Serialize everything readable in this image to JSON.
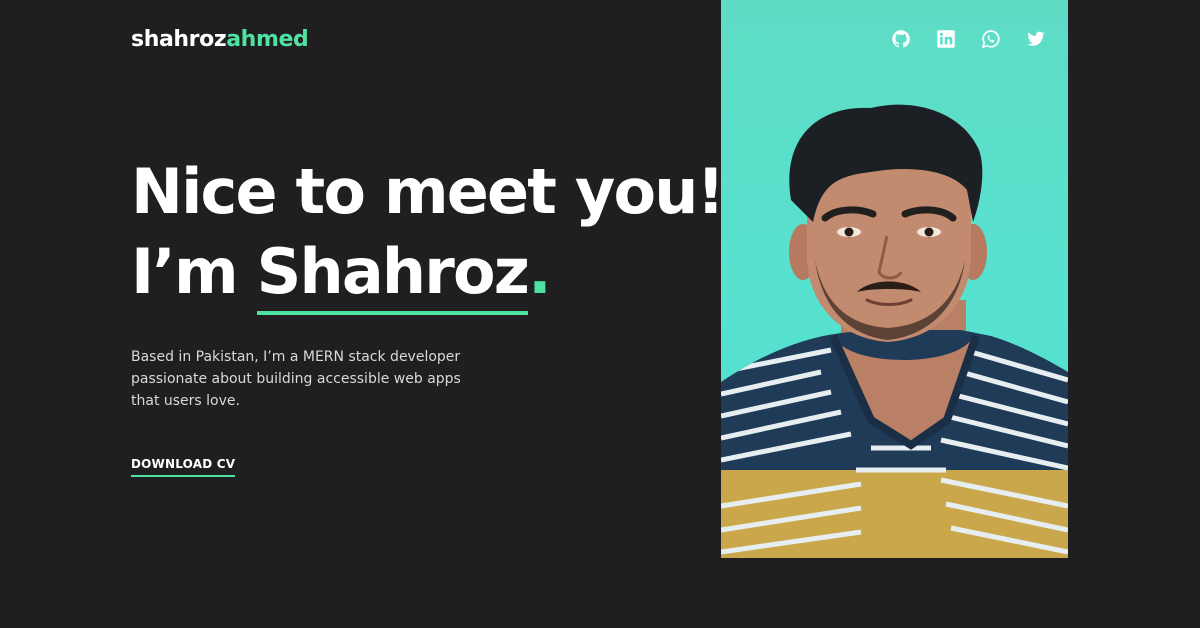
{
  "logo": {
    "first": "shahroz",
    "last": "ahmed"
  },
  "social": [
    {
      "name": "github-icon",
      "label": "GitHub"
    },
    {
      "name": "linkedin-icon",
      "label": "LinkedIn"
    },
    {
      "name": "whatsapp-icon",
      "label": "WhatsApp"
    },
    {
      "name": "twitter-icon",
      "label": "Twitter"
    }
  ],
  "hero": {
    "line1": "Nice to meet you!",
    "line2_prefix": "I’m ",
    "name": "Shahroz",
    "dot": ".",
    "intro": "Based in Pakistan, I’m a MERN stack developer passionate about building accessible web apps that users love.",
    "cta": "DOWNLOAD CV"
  },
  "colors": {
    "background": "#1f1f21",
    "accent": "#4ee1a0",
    "photo_background": "#5fdcc6"
  }
}
